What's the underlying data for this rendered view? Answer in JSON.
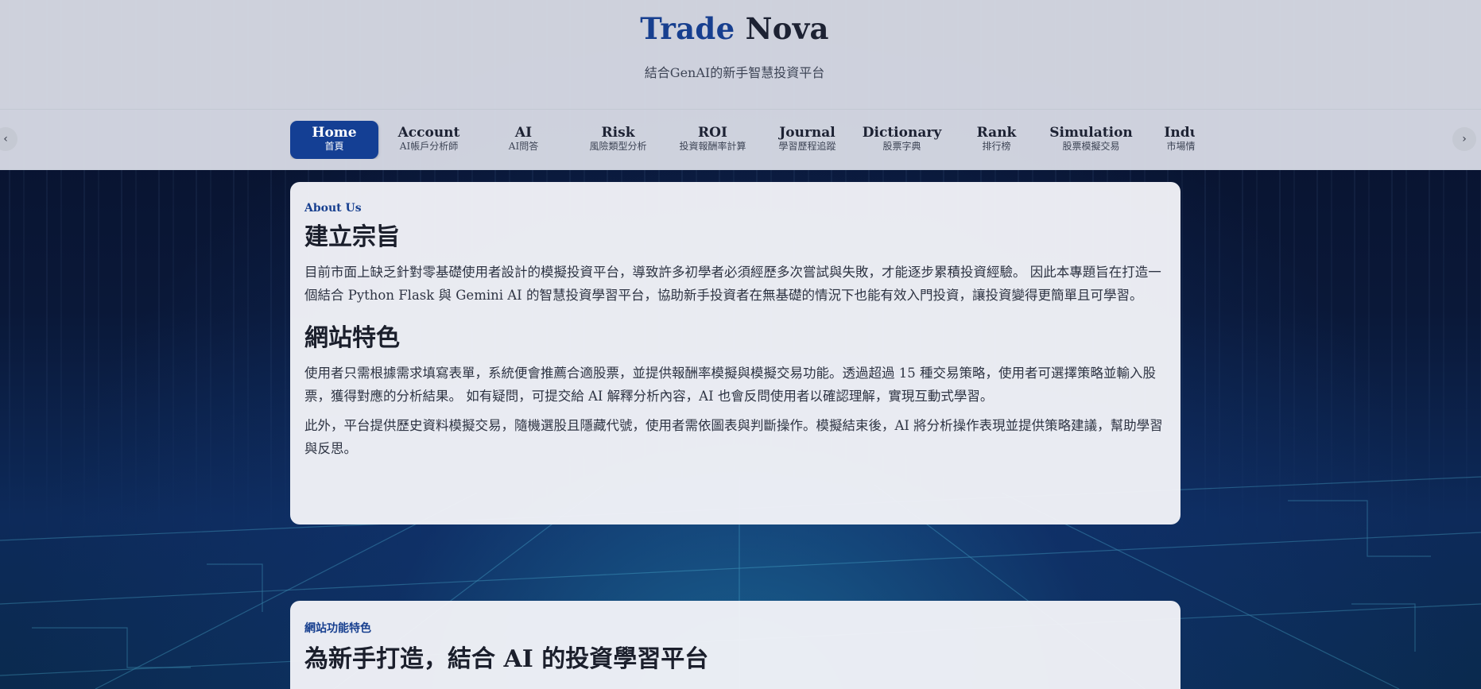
{
  "brand": {
    "part1": "Trade",
    "part2": "Nova",
    "accent_color": "#173f8f"
  },
  "tagline": "結合GenAI的新手智慧投資平台",
  "nav": {
    "prev_icon": "chevron-left-icon",
    "next_icon": "chevron-right-icon",
    "prev_glyph": "‹",
    "next_glyph": "›",
    "items": [
      {
        "en": "Home",
        "zh": "首頁",
        "active": true
      },
      {
        "en": "Account",
        "zh": "AI帳戶分析師"
      },
      {
        "en": "AI",
        "zh": "AI問答"
      },
      {
        "en": "Risk",
        "zh": "風險類型分析"
      },
      {
        "en": "ROI",
        "zh": "投資報酬率計算"
      },
      {
        "en": "Journal",
        "zh": "學習歷程追蹤"
      },
      {
        "en": "Dictionary",
        "zh": "股票字典"
      },
      {
        "en": "Rank",
        "zh": "排行榜"
      },
      {
        "en": "Simulation",
        "zh": "股票模擬交易"
      },
      {
        "en": "Indus",
        "zh": "市場情勢"
      }
    ]
  },
  "about": {
    "eyebrow": "About Us",
    "heading1": "建立宗旨",
    "para1": "目前市面上缺乏針對零基礎使用者設計的模擬投資平台，導致許多初學者必須經歷多次嘗試與失敗，才能逐步累積投資經驗。 因此本專題旨在打造一個結合 Python Flask 與 Gemini AI 的智慧投資學習平台，協助新手投資者在無基礎的情況下也能有效入門投資，讓投資變得更簡單且可學習。",
    "heading2": "網站特色",
    "para2": "使用者只需根據需求填寫表單，系統便會推薦合適股票，並提供報酬率模擬與模擬交易功能。透過超過 15 種交易策略，使用者可選擇策略並輸入股票，獲得對應的分析結果。 如有疑問，可提交給 AI 解釋分析內容，AI 也會反問使用者以確認理解，實現互動式學習。",
    "para3": "此外，平台提供歷史資料模擬交易，隨機選股且隱藏代號，使用者需依圖表與判斷操作。模擬結束後，AI 將分析操作表現並提供策略建議，幫助學習與反思。"
  },
  "features": {
    "eyebrow": "網站功能特色",
    "heading": "為新手打造，結合 AI 的投資學習平台"
  }
}
